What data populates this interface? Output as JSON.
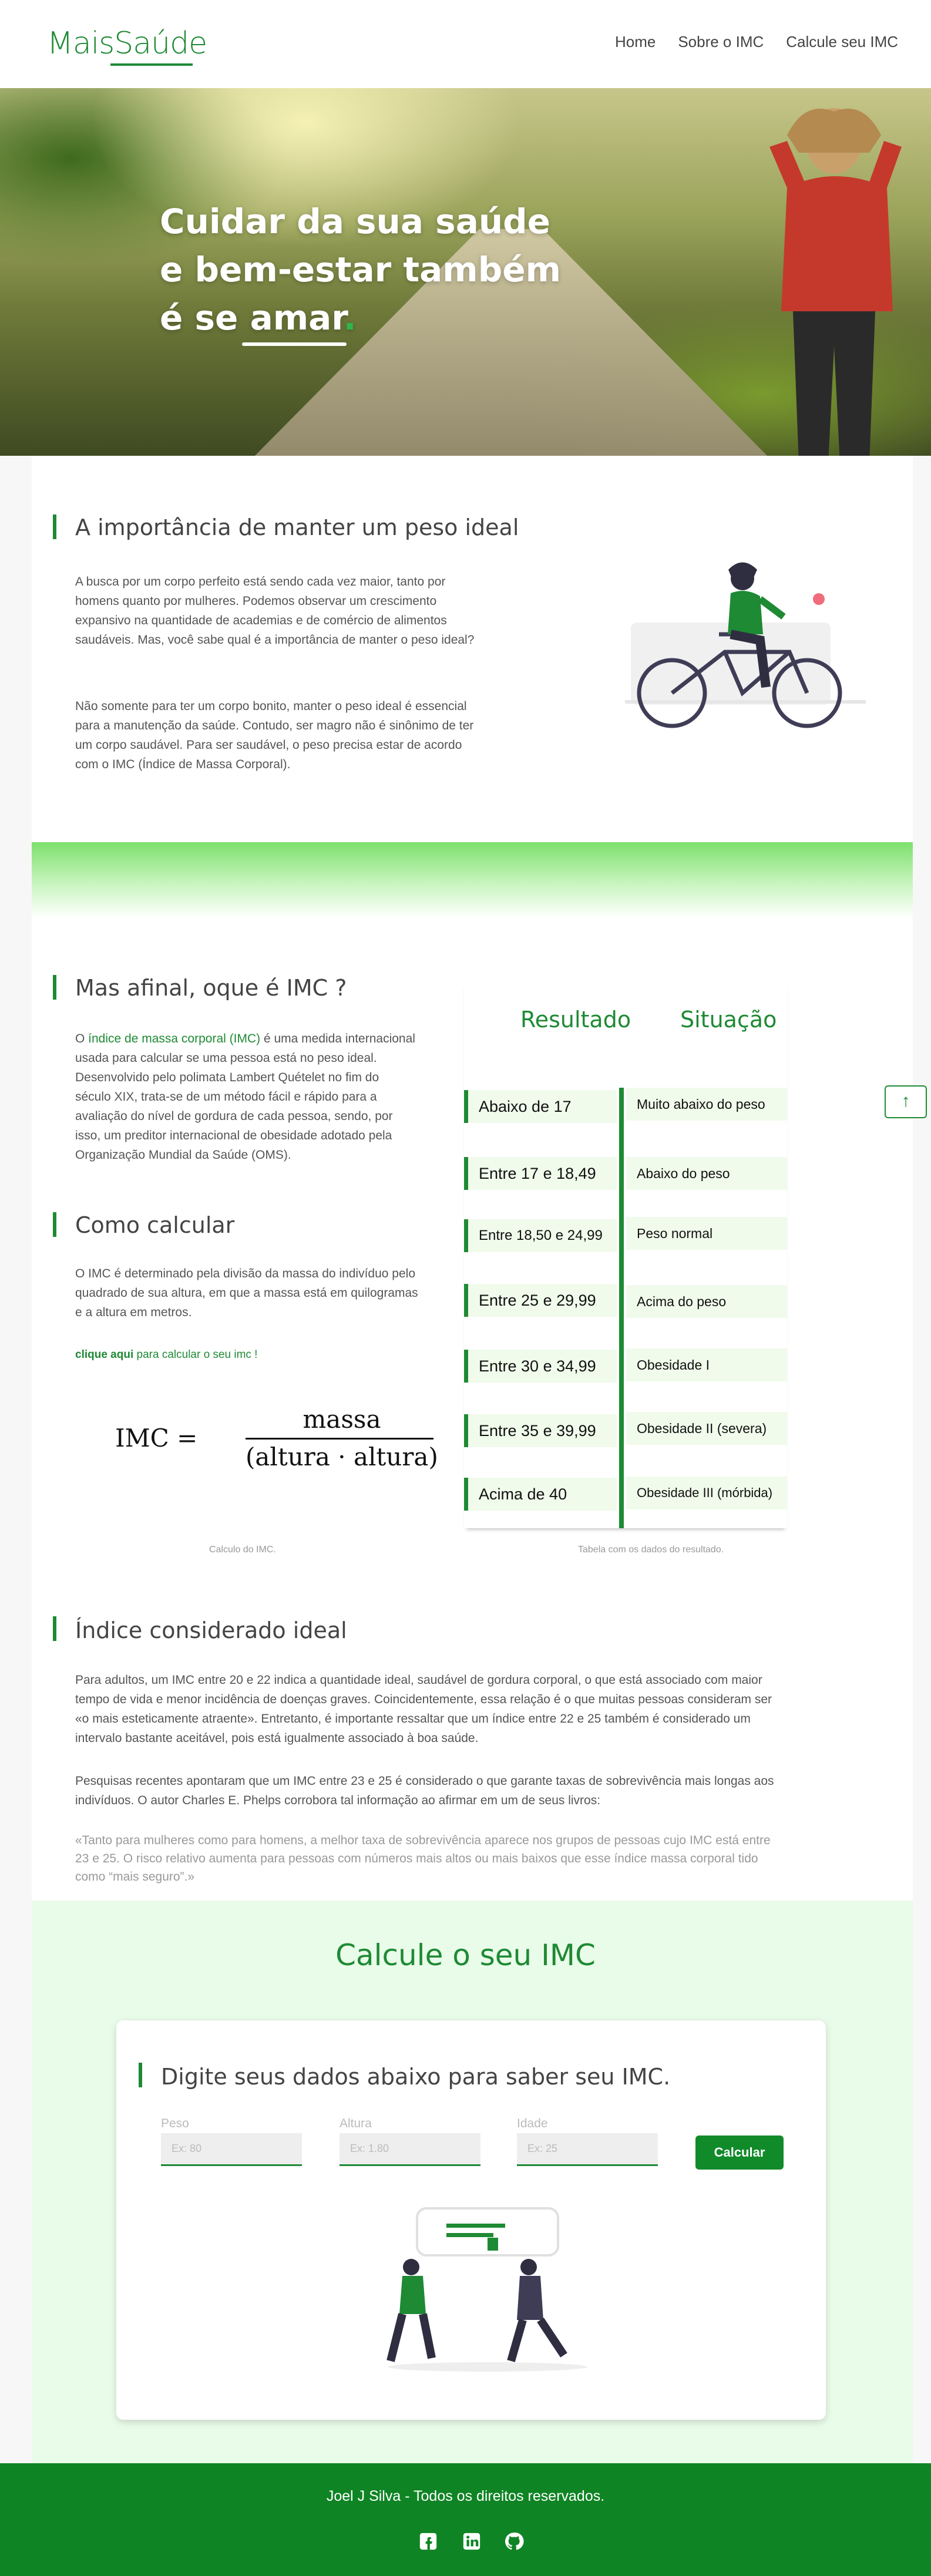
{
  "brand": {
    "logo": "MaisSaúde"
  },
  "nav": {
    "links": [
      "Home",
      "Sobre o IMC",
      "Calcule seu IMC"
    ]
  },
  "hero": {
    "line1": "Cuidar da sua saúde",
    "line2": "e bem-estar também",
    "line3_prefix": "é se ",
    "line3_word": "amar",
    "line3_dot": "."
  },
  "importance": {
    "title": "A importância de manter um peso ideal",
    "p1": "A busca por um corpo perfeito está sendo cada vez maior, tanto por homens quanto por mulheres. Podemos observar um crescimento expansivo na quantidade de academias e de comércio de alimentos saudáveis. Mas, você sabe qual é a importância de manter o peso ideal?",
    "p2": "Não somente para ter um corpo bonito, manter o peso ideal é essencial para a manutenção da saúde. Contudo, ser magro não é sinônimo de ter um corpo saudável. Para ser saudável, o peso precisa estar de acordo com o IMC (Índice de Massa Corporal)."
  },
  "what_is": {
    "title": "Mas afinal, oque é IMC ?",
    "p1_prefix": "O ",
    "p1_link": "índice de massa corporal (IMC)",
    "p1_rest": " é uma medida internacional usada para calcular se uma pessoa está no peso ideal. Desenvolvido pelo polimata Lambert Quételet no fim do século XIX, trata-se de um método fácil e rápido para a avaliação do nível de gordura de cada pessoa, sendo, por isso, um preditor internacional de obesidade adotado pela Organização Mundial da Saúde (OMS)."
  },
  "how_calc": {
    "title": "Como calcular",
    "p1": "O IMC é determinado pela divisão da massa do indivíduo pelo quadrado de sua altura, em que a massa está em quilogramas e a altura em metros.",
    "link_strong": "clique aqui",
    "link_rest": " para calcular o seu imc !",
    "formula_lhs": "IMC =",
    "formula_num": "massa",
    "formula_den": "(altura · altura)",
    "caption": "Calculo do IMC."
  },
  "table": {
    "head_result": "Resultado",
    "head_situation": "Situação",
    "rows": [
      {
        "result": "Abaixo de 17",
        "situation": "Muito abaixo do peso"
      },
      {
        "result": "Entre 17 e 18,49",
        "situation": "Abaixo do peso"
      },
      {
        "result": "Entre 18,50 e 24,99",
        "situation": "Peso normal"
      },
      {
        "result": "Entre 25 e 29,99",
        "situation": "Acima do peso"
      },
      {
        "result": "Entre 30 e 34,99",
        "situation": "Obesidade I"
      },
      {
        "result": "Entre 35 e 39,99",
        "situation": "Obesidade II (severa)"
      },
      {
        "result": "Acima de 40",
        "situation": "Obesidade III (mórbida)"
      }
    ],
    "caption": "Tabela com os dados do resultado."
  },
  "ideal": {
    "title": "Índice considerado ideal",
    "p1": "Para adultos, um IMC entre 20 e 22 indica a quantidade ideal, saudável de gordura corporal, o que está associado com maior tempo de vida e menor incidência de doenças graves. Coincidentemente, essa relação é o que muitas pessoas consideram ser «o mais esteticamente atraente». Entretanto, é importante ressaltar que um índice entre 22 e 25 também é considerado um intervalo bastante aceitável, pois está igualmente associado à boa saúde.",
    "p2": "Pesquisas recentes apontaram que um IMC entre 23 e 25 é considerado o que garante taxas de sobrevivência mais longas aos indivíduos. O autor Charles E. Phelps corrobora tal informação ao afirmar em um de seus livros:",
    "quote": "«Tanto para mulheres como para homens, a melhor taxa de sobrevivência aparece nos grupos de pessoas cujo IMC está entre 23 e 25. O risco relativo aumenta para pessoas com números mais altos ou mais baixos que esse índice massa corporal tido como “mais seguro”.»"
  },
  "calc": {
    "title": "Calcule o seu IMC",
    "subtitle": "Digite seus dados abaixo para saber seu IMC.",
    "fields": [
      {
        "label": "Peso",
        "placeholder": "Ex: 80"
      },
      {
        "label": "Altura",
        "placeholder": "Ex: 1.80"
      },
      {
        "label": "Idade",
        "placeholder": "Ex: 25"
      }
    ],
    "button": "Calcular"
  },
  "footer": {
    "text": "Joel J Silva - Todos os direitos reservados.",
    "icons": [
      "facebook-icon",
      "linkedin-icon",
      "github-icon"
    ]
  },
  "scroll_top": "↑",
  "colors": {
    "primary": "#1e8a34",
    "footer": "#0f8424",
    "calc_bg": "#e9fbe9"
  }
}
